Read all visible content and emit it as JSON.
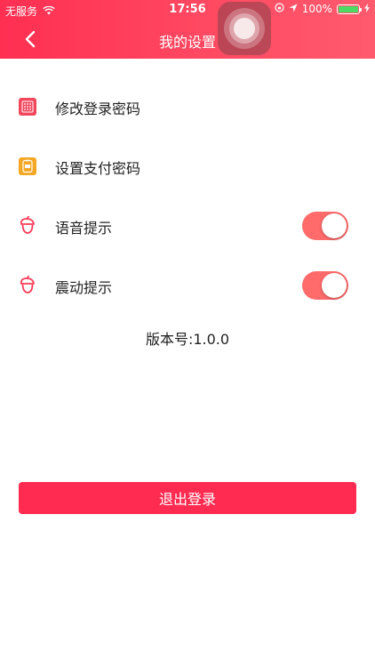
{
  "status_bar": {
    "carrier": "无服务",
    "time": "17:56",
    "battery": "100%"
  },
  "nav": {
    "title": "我的设置"
  },
  "settings": [
    {
      "label": "修改登录密码",
      "icon": "keypad-icon"
    },
    {
      "label": "设置支付密码",
      "icon": "wallet-icon"
    },
    {
      "label": "语音提示",
      "icon": "acorn-icon",
      "toggle": true
    },
    {
      "label": "震动提示",
      "icon": "acorn-icon",
      "toggle": true
    }
  ],
  "version": "版本号:1.0.0",
  "logout_label": "退出登录",
  "colors": {
    "header": "#ff3a58",
    "toggle_on": "#ff6b6b",
    "logout": "#ff2b51"
  }
}
